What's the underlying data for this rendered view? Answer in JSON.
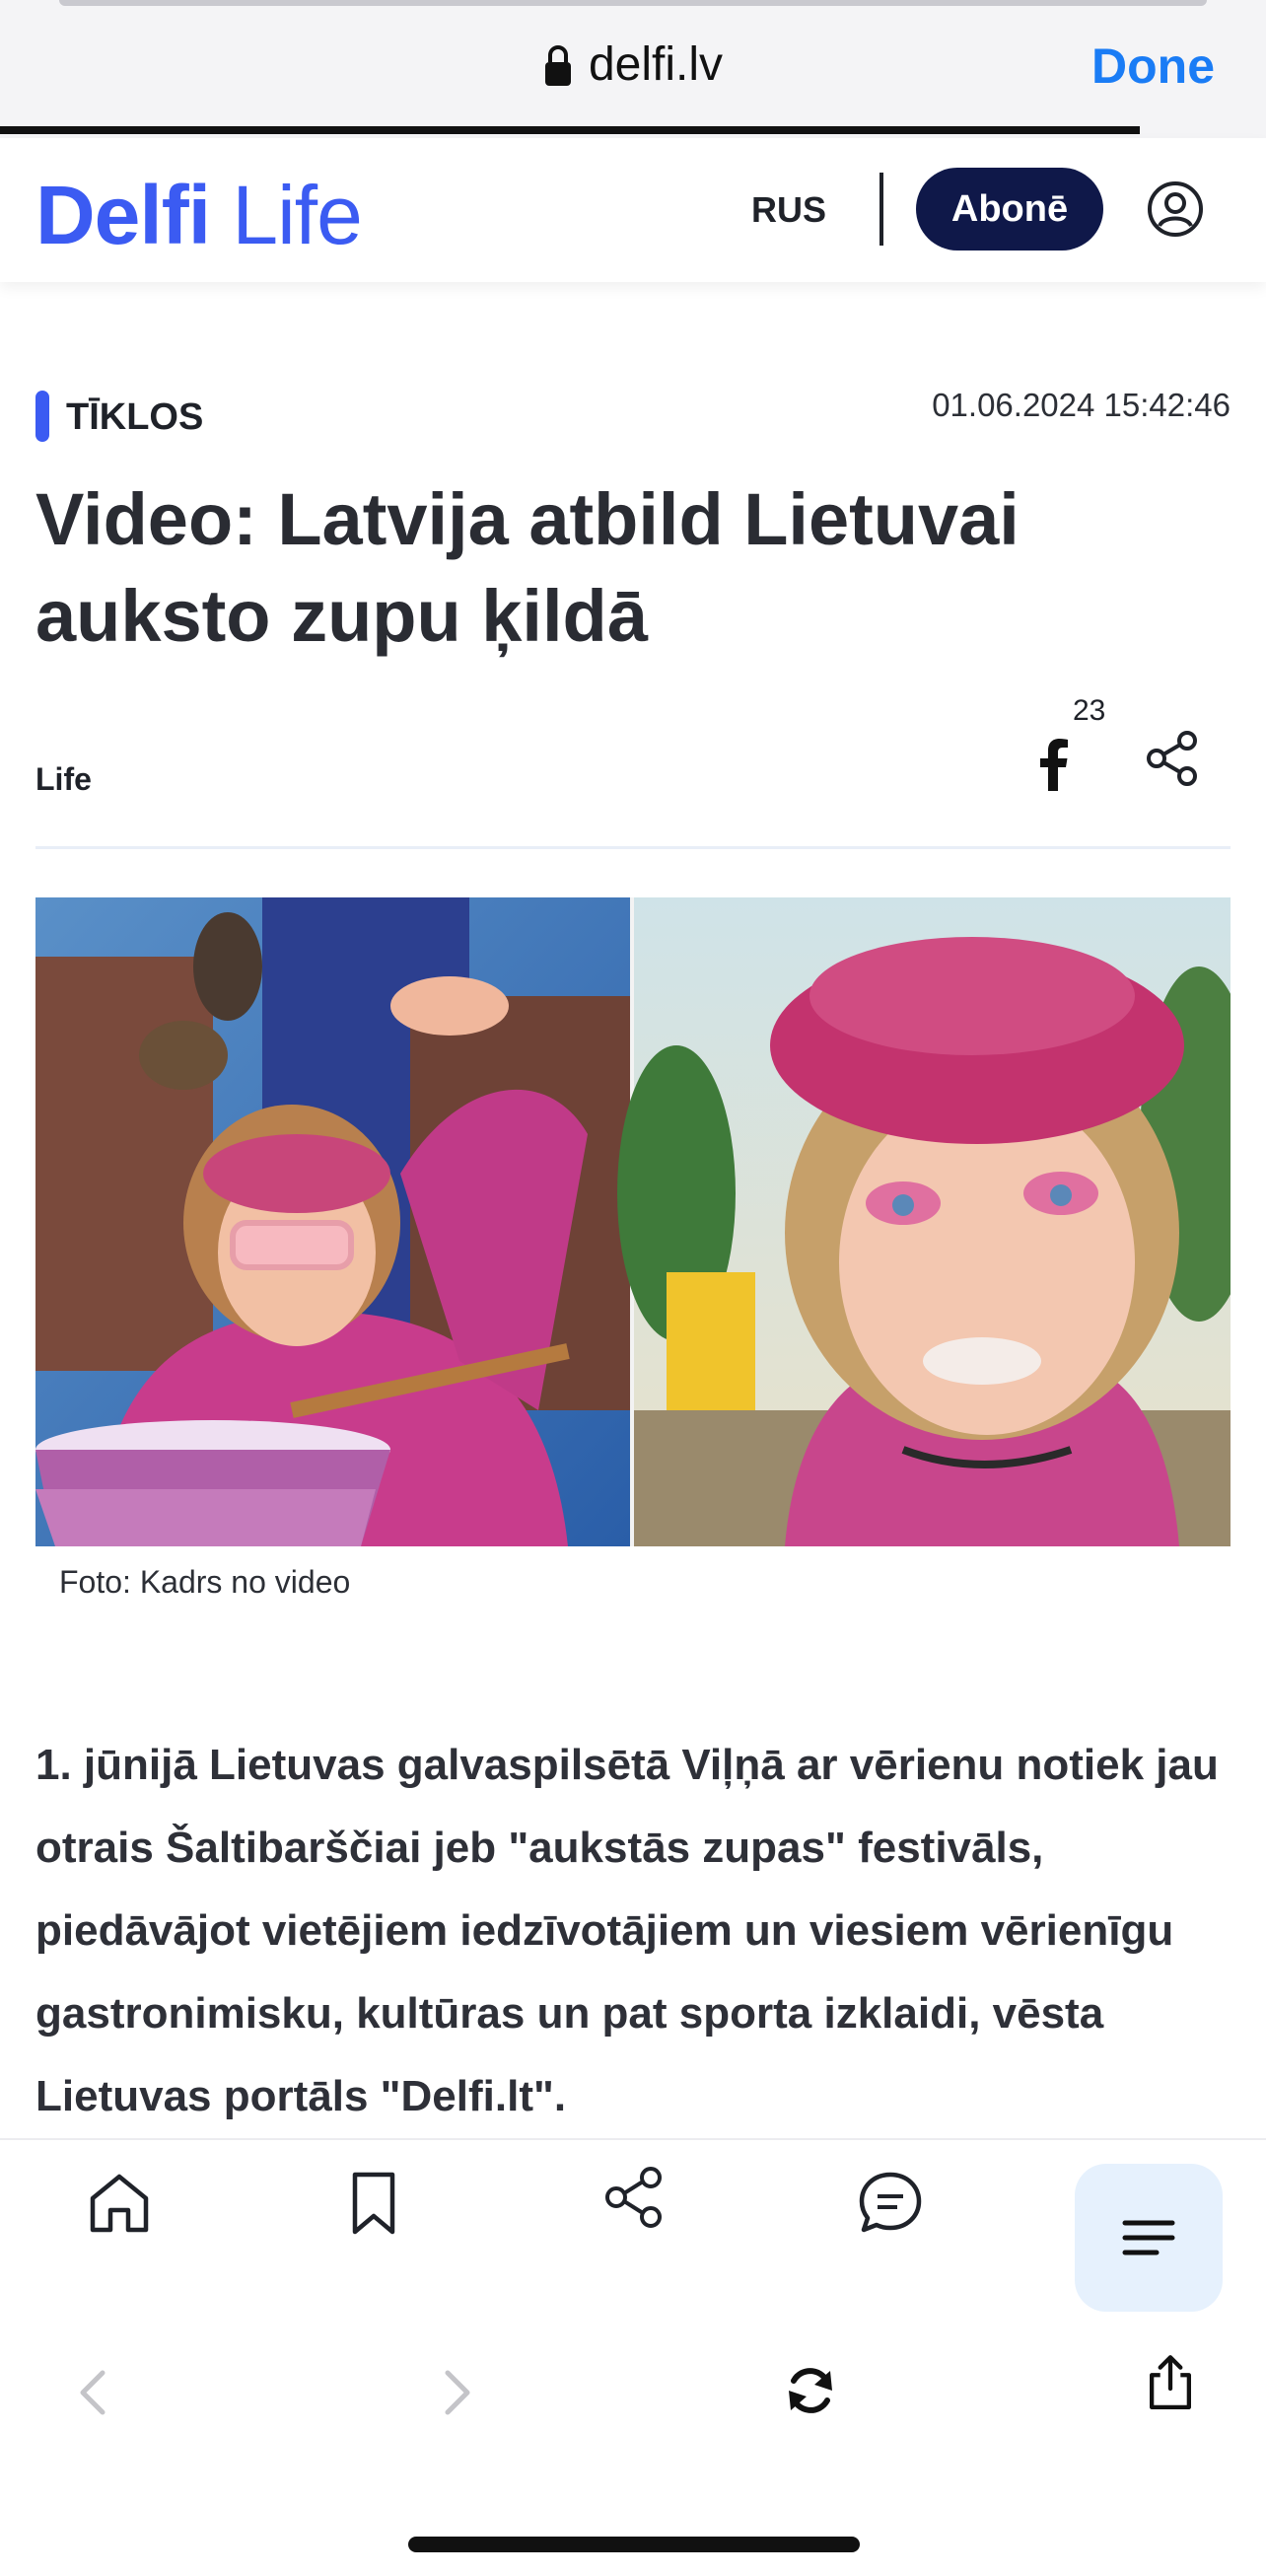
{
  "browser": {
    "url": "delfi.lv",
    "done_label": "Done",
    "load_progress": 0.9
  },
  "header": {
    "logo_brand": "Delfi",
    "logo_section": "Life",
    "language_label": "RUS",
    "subscribe_label": "Abonē",
    "accent_color": "#3b5bf2",
    "subscribe_color": "#0f1849"
  },
  "article": {
    "category": "TĪKLOS",
    "datetime": "01.06.2024 15:42:46",
    "headline": "Video: Latvija atbild Lietuvai auksto zupu ķildā",
    "section": "Life",
    "facebook_count": "23",
    "image_caption": "Foto: Kadrs no video",
    "body": "1. jūnijā Lietuvas galvaspilsētā Viļņā ar vērienu notiek jau otrais Šaltibarščiai jeb \"aukstās zupas\" festivāls, piedāvājot vietējiem iedzīvotājiem un viesiem vērienīgu gastronimisku, kultūras un pat sporta izklaidi, vēsta Lietuvas portāls \"Delfi.lt\"."
  },
  "toolbar": {
    "icons": [
      "home-icon",
      "bookmark-icon",
      "share-icon",
      "comments-icon",
      "menu-icon"
    ]
  },
  "safari_nav": {
    "icons": [
      "back-icon",
      "forward-icon",
      "reload-icon",
      "share-icon"
    ]
  }
}
